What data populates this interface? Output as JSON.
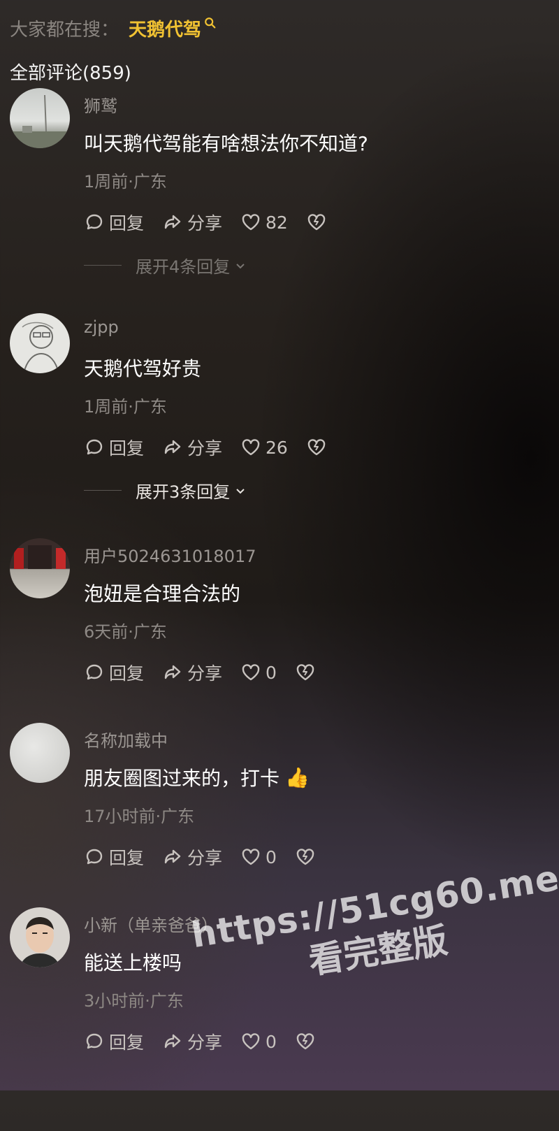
{
  "search": {
    "prefix": "大家都在搜：",
    "term": "天鹅代驾",
    "icon": "search-icon"
  },
  "comment_count": "全部评论(859)",
  "actions": {
    "reply": "回复",
    "share": "分享"
  },
  "comments": [
    {
      "username": "狮鹫",
      "content": "叫天鹅代驾能有啥想法你不知道?",
      "emoji": "",
      "meta": "1周前·广东",
      "likes": "82",
      "expand": "展开4条回复",
      "avatar": "avatar-landscape"
    },
    {
      "username": "zjpp",
      "content": "天鹅代驾好贵",
      "emoji": "",
      "meta": "1周前·广东",
      "likes": "26",
      "expand": "展开3条回复",
      "avatar": "avatar-sketch"
    },
    {
      "username": "用户5024631018017",
      "content": "泡妞是合理合法的",
      "emoji": "",
      "meta": "6天前·广东",
      "likes": "0",
      "expand": "",
      "avatar": "avatar-street"
    },
    {
      "username": "名称加载中",
      "content": "朋友圈图过来的，打卡",
      "emoji": "👍",
      "meta": "17小时前·广东",
      "likes": "0",
      "expand": "",
      "avatar": "avatar-blank"
    },
    {
      "username": "小新（单亲爸爸）",
      "content": "能送上楼吗",
      "emoji": "",
      "meta": "3小时前·广东",
      "likes": "0",
      "expand": "",
      "avatar": "avatar-face"
    }
  ],
  "watermark": {
    "line1": "https://51cg60.me",
    "line2": "看完整版"
  },
  "colors": {
    "accent": "#f1c232",
    "text": "#ffffff",
    "muted": "#8e8985"
  }
}
